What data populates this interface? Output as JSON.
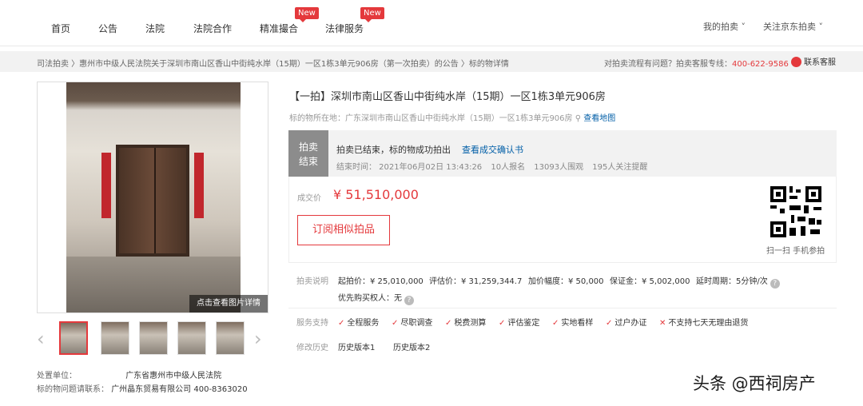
{
  "topnav": {
    "items": [
      "首页",
      "公告",
      "法院",
      "法院合作",
      "精准撮合",
      "法律服务"
    ],
    "new_badge": "New",
    "my_auction": "我的拍卖",
    "follow": "关注京东拍卖"
  },
  "breadcrumb": {
    "text": "司法拍卖 〉惠州市中级人民法院关于深圳市南山区香山中街纯水岸（15期）一区1栋3单元906房（第一次拍卖）的公告 〉标的物详情",
    "help_prefix": "对拍卖流程有问题？拍卖客服专线：",
    "phone": "400-622-9586",
    "service": "联系客服"
  },
  "gallery": {
    "overlay": "点击查看图片详情",
    "thumb_count": 5
  },
  "owner": {
    "label": "处置单位：",
    "value": "广东省惠州市中级人民法院",
    "contact_label": "标的物问题请联系：",
    "contact_value": "广州晶东贸易有限公司 400-8363020"
  },
  "item": {
    "title": "【一拍】深圳市南山区香山中街纯水岸（15期）一区1栋3单元906房",
    "location_label": "标的物所在地：",
    "location": "广东深圳市南山区香山中街纯水岸（15期）一区1栋3单元906房",
    "map_link": "查看地图"
  },
  "status": {
    "tag_line1": "拍卖",
    "tag_line2": "结束",
    "text": "拍卖已结束，标的物成功拍出",
    "confirm_link": "查看成交确认书",
    "end_time": "结束时间：  2021年06月02日 13:43:26",
    "signups": "10人报名",
    "views": "13093人围观",
    "reminders": "195人关注提醒"
  },
  "price": {
    "label": "成交价",
    "value": "¥ 51,510,000",
    "subscribe": "订阅相似拍品",
    "qr_label": "扫一扫 手机参拍"
  },
  "details": {
    "label": "拍卖说明",
    "start_price": "起拍价：¥ 25,010,000",
    "appraisal": "评估价：¥ 31,259,344.7",
    "increment": "加价幅度：¥ 50,000",
    "deposit": "保证金：¥ 5,002,000",
    "extension": "延时周期：5分钟/次",
    "priority": "优先购买权人：无"
  },
  "services": {
    "label": "服务支持",
    "items": [
      "全程服务",
      "尽职调查",
      "税费测算",
      "评估鉴定",
      "实地看样",
      "过户办证"
    ],
    "negative": "不支持七天无理由退货"
  },
  "history": {
    "label": "修改历史",
    "v1": "历史版本1",
    "v2": "历史版本2"
  },
  "watermark": "头条 @西祠房产",
  "colors": {
    "accent": "#e4393c",
    "link": "#005ea7"
  }
}
